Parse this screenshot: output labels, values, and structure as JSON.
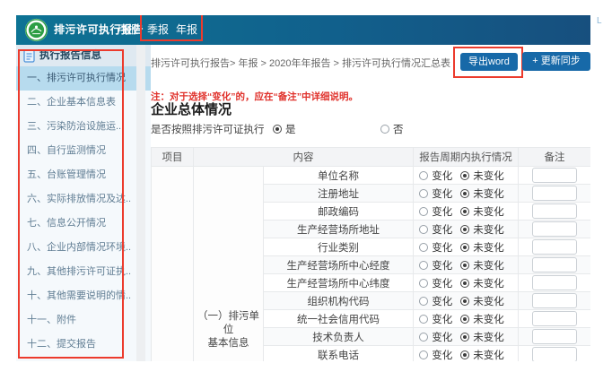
{
  "topbar": {
    "title": "排污许可执行报告",
    "nav": [
      {
        "label": "月报"
      },
      {
        "label": "季报"
      },
      {
        "label": "年报"
      }
    ],
    "corner_fragment": "L"
  },
  "sidebar": {
    "header": "执行报告信息",
    "items": [
      {
        "label": "一、排污许可执行情况",
        "selected": true
      },
      {
        "label": "二、企业基本信息表",
        "selected": false
      },
      {
        "label": "三、污染防治设施运..",
        "selected": false
      },
      {
        "label": "四、自行监测情况",
        "selected": false
      },
      {
        "label": "五、台账管理情况",
        "selected": false
      },
      {
        "label": "六、实际排放情况及达..",
        "selected": false
      },
      {
        "label": "七、信息公开情况",
        "selected": false
      },
      {
        "label": "八、企业内部情况环境..",
        "selected": false
      },
      {
        "label": "九、其他排污许可证执..",
        "selected": false
      },
      {
        "label": "十、其他需要说明的情..",
        "selected": false
      },
      {
        "label": "十一、附件",
        "selected": false
      },
      {
        "label": "十二、提交报告",
        "selected": false
      }
    ]
  },
  "breadcrumb": "排污许可执行报告> 年报 > 2020年年报告 > 排污许可执行情况汇总表",
  "actions": {
    "export_word": "导出word",
    "sync": "+ 更新同步数据"
  },
  "note": "注：对于选择“变化”的，应在“备注”中详细说明。",
  "section": {
    "title": "企业总体情况",
    "compliance_label": "是否按照排污许可证执行",
    "yes": "是",
    "no": "否",
    "selected": "是"
  },
  "table": {
    "headers": {
      "project": "项目",
      "content": "内容",
      "status": "报告周期内执行情况",
      "remark": "备注"
    },
    "group_label_lines": [
      "（一）排污单位",
      "基本信息"
    ],
    "options": {
      "changed": "变化",
      "unchanged": "未变化"
    },
    "rows": [
      {
        "field": "单位名称",
        "status": "未变化"
      },
      {
        "field": "注册地址",
        "status": "未变化"
      },
      {
        "field": "邮政编码",
        "status": "未变化"
      },
      {
        "field": "生产经营场所地址",
        "status": "未变化"
      },
      {
        "field": "行业类别",
        "status": "未变化"
      },
      {
        "field": "生产经营场所中心经度",
        "status": "未变化"
      },
      {
        "field": "生产经营场所中心纬度",
        "status": "未变化"
      },
      {
        "field": "组织机构代码",
        "status": "未变化"
      },
      {
        "field": "统一社会信用代码",
        "status": "未变化"
      },
      {
        "field": "技术负责人",
        "status": "未变化"
      },
      {
        "field": "联系电话",
        "status": "未变化"
      }
    ]
  },
  "colors": {
    "topbar_left": "#0d7394",
    "topbar_right": "#174f7e",
    "button_blue": "#1769a8",
    "annotation_red": "#ec3b2d",
    "note_red": "#e0312b",
    "selected_item_bg": "#b7dbee"
  }
}
